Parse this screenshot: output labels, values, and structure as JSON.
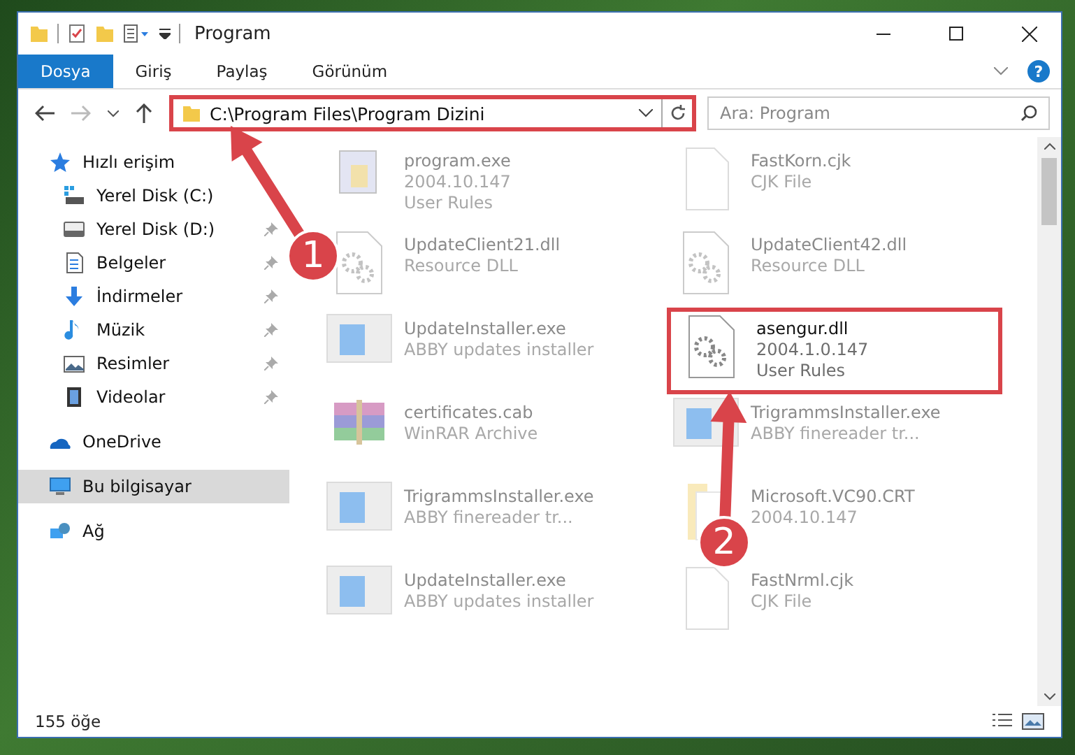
{
  "window": {
    "title": "Program"
  },
  "ribbon": {
    "tabs": [
      {
        "label": "Dosya",
        "selected": true
      },
      {
        "label": "Giriş",
        "selected": false
      },
      {
        "label": "Paylaş",
        "selected": false
      },
      {
        "label": "Görünüm",
        "selected": false
      }
    ],
    "help": "?"
  },
  "address_bar": {
    "path": "C:\\Program Files\\Program Dizini",
    "highlighted": true
  },
  "search": {
    "placeholder": "Ara: Program"
  },
  "sidebar": {
    "items": [
      {
        "label": "Hızlı erişim",
        "kind": "star",
        "pinned": false,
        "selected": false,
        "children": [
          {
            "label": "Yerel Disk (C:)",
            "kind": "drive-windows",
            "pinned": false,
            "selected": false
          },
          {
            "label": "Yerel Disk (D:)",
            "kind": "drive",
            "pinned": true,
            "selected": false
          },
          {
            "label": "Belgeler",
            "kind": "document",
            "pinned": true,
            "selected": false
          },
          {
            "label": "İndirmeler",
            "kind": "download",
            "pinned": true,
            "selected": false
          },
          {
            "label": "Müzik",
            "kind": "music",
            "pinned": true,
            "selected": false
          },
          {
            "label": "Resimler",
            "kind": "pictures",
            "pinned": true,
            "selected": false
          },
          {
            "label": "Videolar",
            "kind": "video",
            "pinned": true,
            "selected": false
          }
        ]
      },
      {
        "label": "OneDrive",
        "kind": "cloud",
        "pinned": false,
        "selected": false
      },
      {
        "label": "Bu bilgisayar",
        "kind": "computer",
        "pinned": false,
        "selected": true
      },
      {
        "label": "Ağ",
        "kind": "network",
        "pinned": false,
        "selected": false
      }
    ]
  },
  "files": [
    {
      "name": "program.exe",
      "lines": [
        "2004.10.147",
        "User Rules"
      ],
      "kind": "program",
      "faded": true,
      "highlighted": false
    },
    {
      "name": "FastKorn.cjk",
      "lines": [
        "CJK File"
      ],
      "kind": "blank",
      "faded": true,
      "highlighted": false
    },
    {
      "name": "UpdateClient21.dll",
      "lines": [
        "Resource DLL"
      ],
      "kind": "dll",
      "faded": true,
      "highlighted": false
    },
    {
      "name": "UpdateClient42.dll",
      "lines": [
        "Resource DLL"
      ],
      "kind": "dll",
      "faded": true,
      "highlighted": false
    },
    {
      "name": "UpdateInstaller.exe",
      "lines": [
        "ABBY updates installer"
      ],
      "kind": "installer",
      "faded": true,
      "highlighted": false
    },
    {
      "name": "asengur.dll",
      "lines": [
        "2004.1.0.147",
        "User Rules"
      ],
      "kind": "dll",
      "faded": false,
      "highlighted": true
    },
    {
      "name": "certificates.cab",
      "lines": [
        "WinRAR Archive"
      ],
      "kind": "archive",
      "faded": true,
      "highlighted": false
    },
    {
      "name": "TrigrammsInstaller.exe",
      "lines": [
        "ABBY finereader tr..."
      ],
      "kind": "installer",
      "faded": true,
      "highlighted": false
    },
    {
      "name": "TrigrammsInstaller.exe",
      "lines": [
        "ABBY finereader tr..."
      ],
      "kind": "installer",
      "faded": true,
      "highlighted": false
    },
    {
      "name": "Microsoft.VC90.CRT",
      "lines": [
        "2004.10.147"
      ],
      "kind": "folder",
      "faded": true,
      "highlighted": false
    },
    {
      "name": "UpdateInstaller.exe",
      "lines": [
        "ABBY updates installer"
      ],
      "kind": "installer",
      "faded": true,
      "highlighted": false
    },
    {
      "name": "FastNrml.cjk",
      "lines": [
        "CJK File"
      ],
      "kind": "blank",
      "faded": true,
      "highlighted": false
    }
  ],
  "status_bar": {
    "count": "155 öğe"
  },
  "annotations": [
    {
      "label": "1"
    },
    {
      "label": "2"
    }
  ]
}
